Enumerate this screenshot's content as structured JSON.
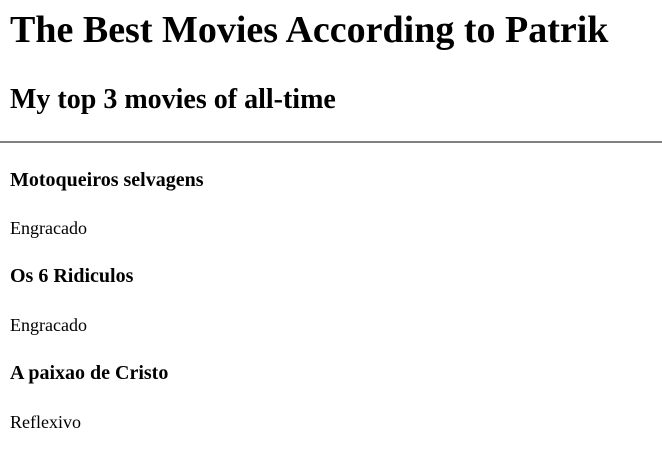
{
  "header": {
    "title": "The Best Movies According to Patrik",
    "subtitle": "My top 3 movies of all-time"
  },
  "movies": [
    {
      "title": "Motoqueiros selvagens",
      "description": "Engracado"
    },
    {
      "title": "Os 6 Ridiculos",
      "description": "Engracado"
    },
    {
      "title": "A paixao de Cristo",
      "description": "Reflexivo"
    }
  ]
}
